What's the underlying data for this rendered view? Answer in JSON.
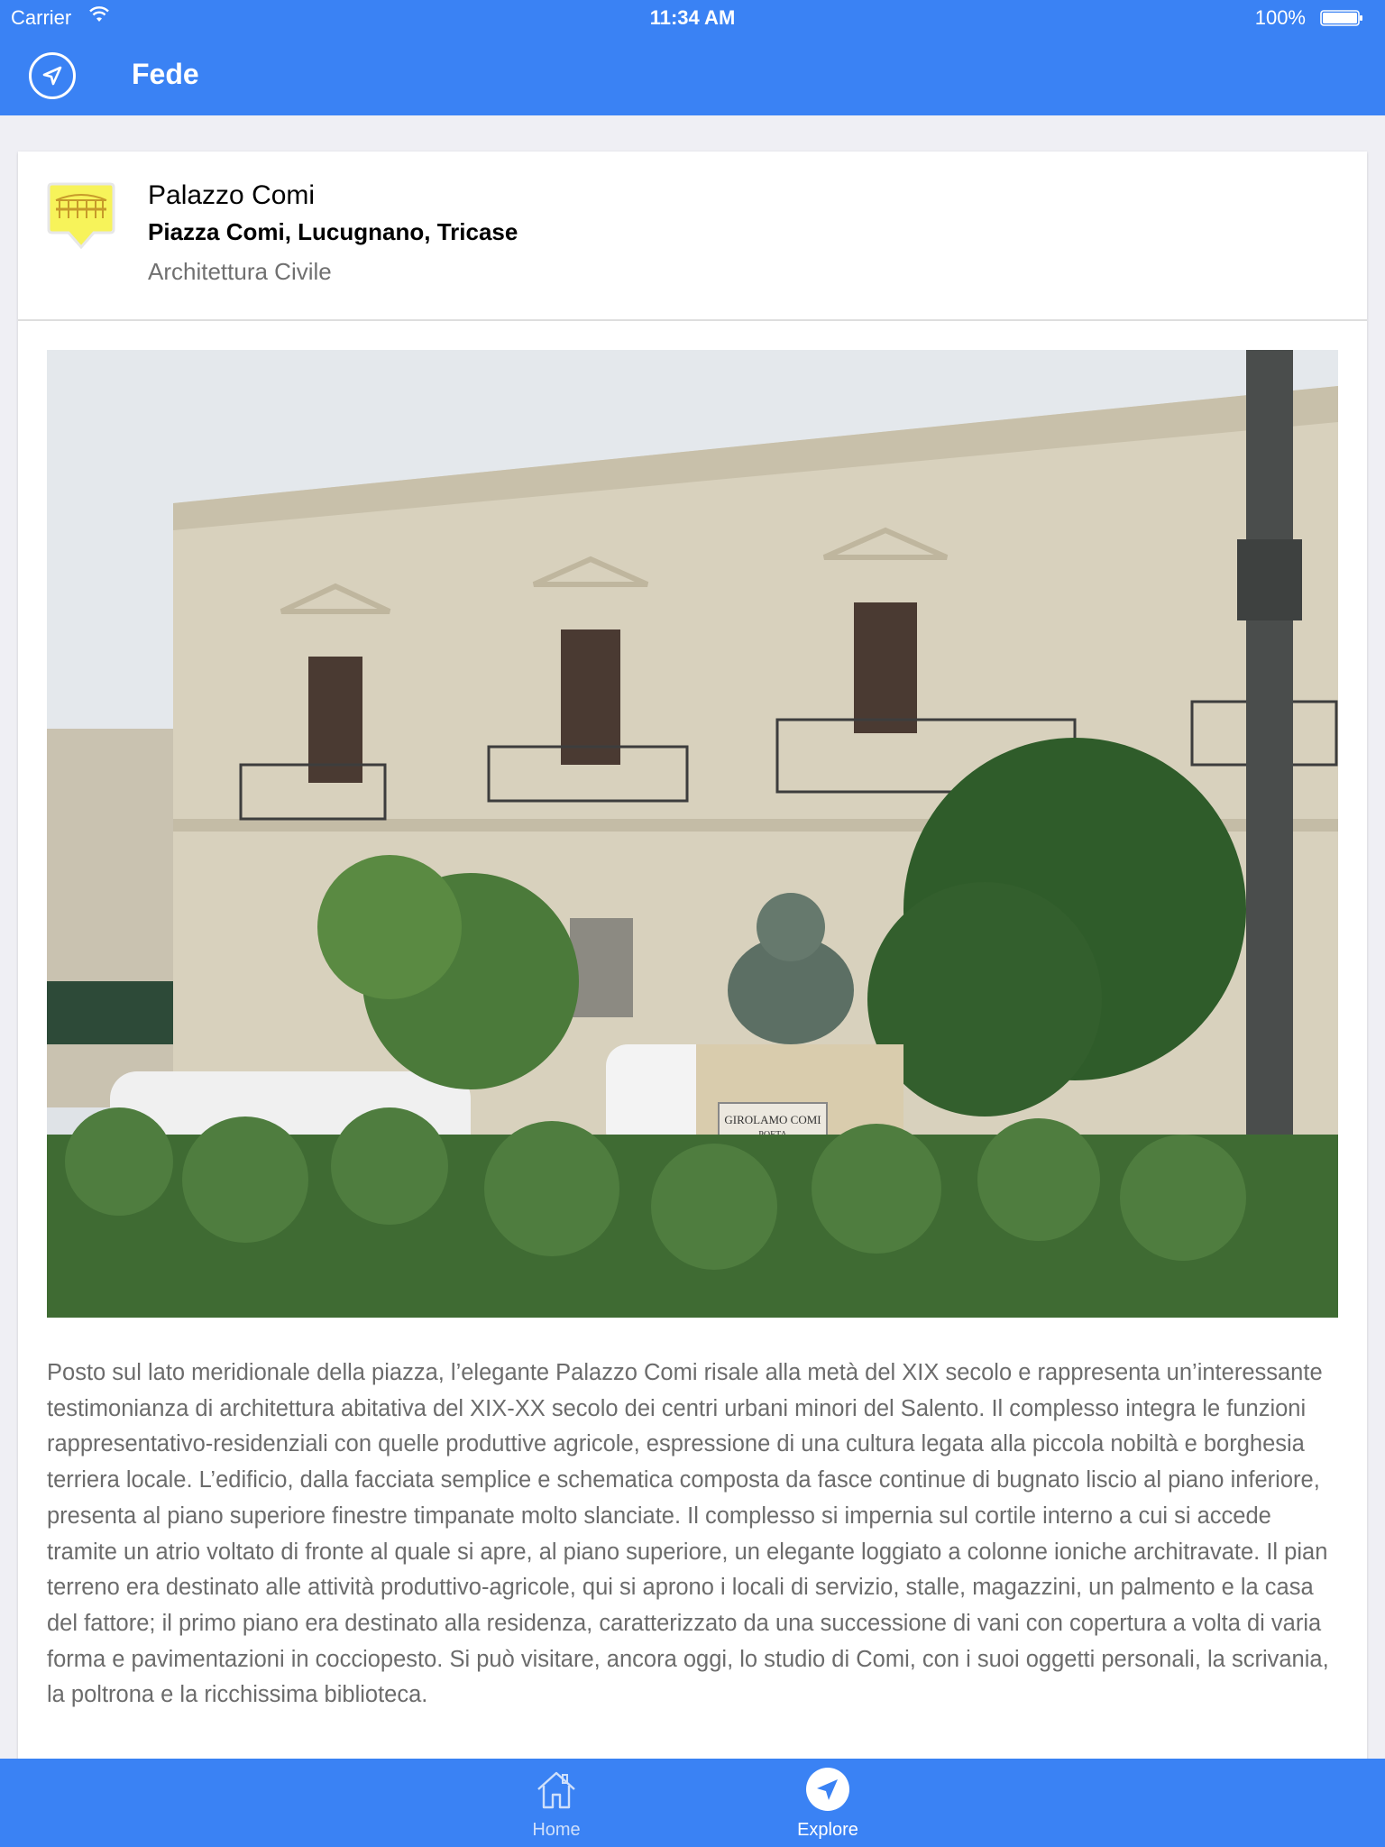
{
  "status_bar": {
    "carrier": "Carrier",
    "time": "11:34 AM",
    "battery": "100%"
  },
  "nav": {
    "title": "Fede",
    "left_icon": "location-arrow-icon"
  },
  "poi": {
    "name": "Palazzo Comi",
    "address": "Piazza Comi, Lucugnano, Tricase",
    "category": "Architettura Civile",
    "icon": "bridge-category-icon",
    "plaque_line1": "GIROLAMO COMI",
    "plaque_line2": "POETA",
    "description": "Posto sul lato meridionale della piazza, l’elegante Palazzo Comi risale alla metà del XIX secolo e rappresenta un’interessante testimonianza di architettura abitativa del XIX-XX secolo dei centri urbani minori del Salento. Il complesso integra le funzioni rappresentativo-residenziali con quelle produttive agricole, espressione di una cultura legata alla piccola nobiltà e borghesia terriera locale. L’edificio, dalla facciata semplice e schematica composta da fasce continue di bugnato liscio al piano inferiore, presenta al piano superiore finestre timpanate molto slanciate. Il complesso si impernia sul cortile interno a cui si accede tramite un atrio voltato di fronte al quale si apre, al piano superiore, un elegante loggiato a colonne ioniche architravate. Il pian terreno era destinato alle attività produttivo-agricole, qui si aprono i locali di servizio, stalle, magazzini, un palmento e la casa del fattore; il primo piano era destinato alla residenza, caratterizzato da una successione di vani con copertura a volta di varia forma e pavimentazioni in cocciopesto. Si può visitare, ancora oggi, lo studio di Comi, con i suoi oggetti personali, la scrivania, la poltrona e la ricchissima biblioteca."
  },
  "tabs": [
    {
      "label": "Home",
      "icon": "home-icon",
      "selected": false
    },
    {
      "label": "Explore",
      "icon": "explore-compass-icon",
      "selected": true
    }
  ],
  "colors": {
    "accent": "#3a82f4",
    "text_secondary": "#707070"
  }
}
